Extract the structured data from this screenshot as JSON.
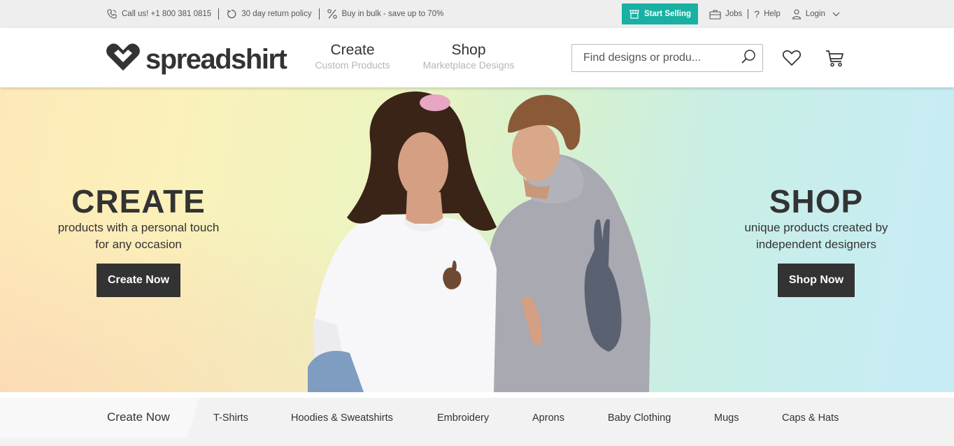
{
  "topbar": {
    "phone_text": "Call us! +1 800 381 0815",
    "returns_text": "30 day return policy",
    "bulk_text": "Buy in bulk - save up to 70%",
    "start_selling_label": "Start Selling",
    "jobs_label": "Jobs",
    "help_label": "Help",
    "login_label": "Login"
  },
  "header": {
    "logo_text": "spreadshirt",
    "nav": [
      {
        "title": "Create",
        "subtitle": "Custom Products"
      },
      {
        "title": "Shop",
        "subtitle": "Marketplace Designs"
      }
    ],
    "search": {
      "placeholder": "Find designs or produ..."
    }
  },
  "hero": {
    "create": {
      "heading": "CREATE",
      "line1": "products with a personal touch",
      "line2": "for any occasion",
      "button": "Create Now"
    },
    "shop": {
      "heading": "SHOP",
      "line1": "unique products created by",
      "line2": "independent designers",
      "button": "Shop Now"
    }
  },
  "categories": {
    "lead": "Create Now",
    "items": [
      "T-Shirts",
      "Hoodies & Sweatshirts",
      "Embroidery",
      "Aprons",
      "Baby Clothing",
      "Mugs",
      "Caps & Hats"
    ]
  },
  "colors": {
    "accent": "#19b1a3",
    "dark_button": "#333333"
  },
  "icons": [
    "phone-icon",
    "return-icon",
    "percent-icon",
    "store-icon",
    "briefcase-icon",
    "help-icon",
    "user-icon",
    "chevron-down-icon",
    "logo-heart-icon",
    "search-icon",
    "heart-icon",
    "cart-icon"
  ]
}
